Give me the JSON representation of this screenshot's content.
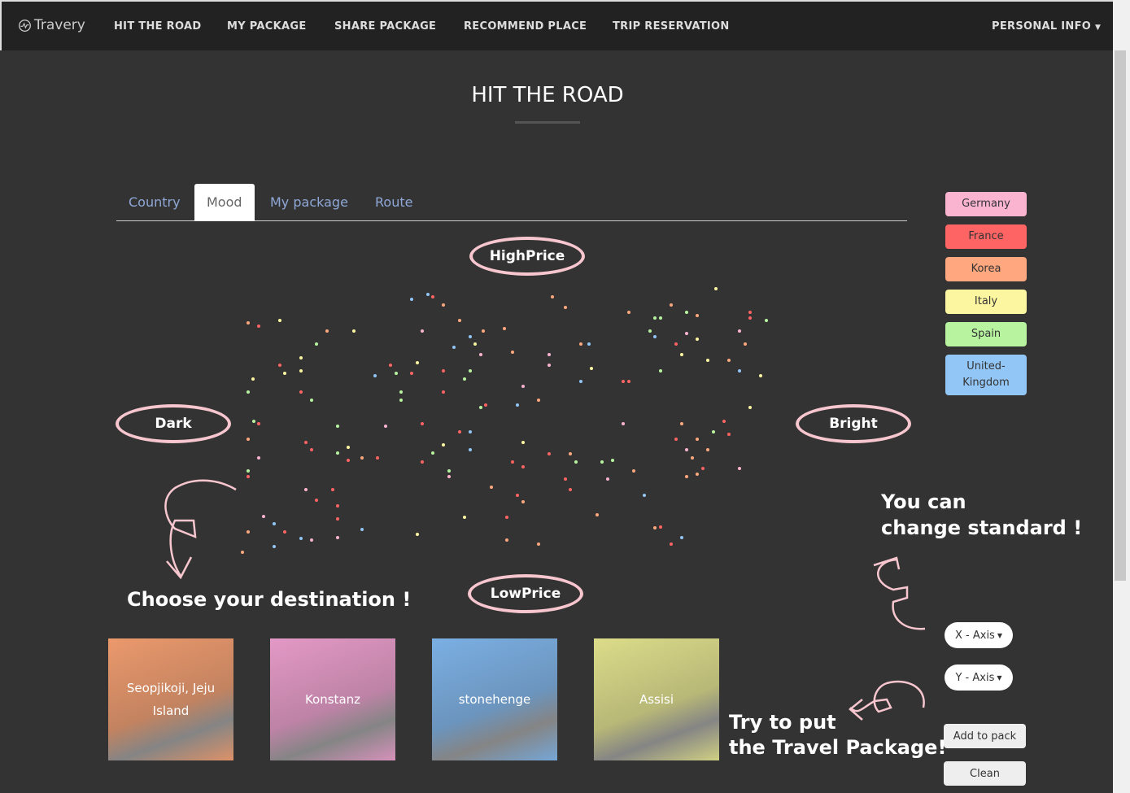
{
  "nav": {
    "brand": "Travery",
    "links": [
      "HIT THE ROAD",
      "MY PACKAGE",
      "SHARE PACKAGE",
      "RECOMMEND PLACE",
      "TRIP RESERVATION"
    ],
    "personal": "PERSONAL INFO"
  },
  "page_title": "HIT THE ROAD",
  "tabs": [
    "Country",
    "Mood",
    "My package",
    "Route"
  ],
  "active_tab": "Mood",
  "axes": {
    "top": "HighPrice",
    "bottom": "LowPrice",
    "left": "Dark",
    "right": "Bright"
  },
  "legend": [
    {
      "label": "Germany",
      "color": "#fbb4d0"
    },
    {
      "label": "France",
      "color": "#ff6464"
    },
    {
      "label": "Korea",
      "color": "#ffa77e"
    },
    {
      "label": "Italy",
      "color": "#fdf6a0"
    },
    {
      "label": "Spain",
      "color": "#b8f4a0"
    },
    {
      "label": "United-Kingdom",
      "color": "#92c6f7"
    }
  ],
  "annotations": {
    "choose": "Choose your destination !",
    "change1": "You can",
    "change2": "change standard !",
    "try1": "Try to put",
    "try2": "the Travel Package!"
  },
  "cards": [
    {
      "label": "Seopjikoji, Jeju Island",
      "tint": "#f8a070"
    },
    {
      "label": "Konstanz",
      "tint": "#f0a0d0"
    },
    {
      "label": "stonehenge",
      "tint": "#80b8f0"
    },
    {
      "label": "Assisi",
      "tint": "#e8e890"
    }
  ],
  "controls": {
    "x_axis": "X - Axis",
    "y_axis": "Y - Axis",
    "add": "Add to pack",
    "clean": "Clean"
  },
  "chart_data": {
    "type": "scatter",
    "xlabel": "Dark → Bright",
    "ylabel": "LowPrice → HighPrice",
    "xlim": [
      0,
      100
    ],
    "ylim": [
      0,
      100
    ],
    "series_key": {
      "G": "Germany",
      "F": "France",
      "K": "Korea",
      "I": "Italy",
      "S": "Spain",
      "U": "United-Kingdom"
    },
    "points": [
      [
        1.5,
        87,
        "K"
      ],
      [
        3.5,
        86,
        "F"
      ],
      [
        7.5,
        88,
        "I"
      ],
      [
        16.5,
        84,
        "K"
      ],
      [
        21.5,
        84,
        "I"
      ],
      [
        14.5,
        79,
        "S"
      ],
      [
        11.5,
        74,
        "I"
      ],
      [
        7.5,
        71,
        "F"
      ],
      [
        8.5,
        68,
        "I"
      ],
      [
        11.5,
        69,
        "I"
      ],
      [
        2.5,
        66,
        "I"
      ],
      [
        1.5,
        61,
        "S"
      ],
      [
        11.5,
        61,
        "F"
      ],
      [
        13.5,
        58,
        "S"
      ],
      [
        2.6,
        50,
        "S"
      ],
      [
        3.5,
        49,
        "F"
      ],
      [
        1.5,
        43,
        "K"
      ],
      [
        12.5,
        42,
        "F"
      ],
      [
        13.5,
        39,
        "F"
      ],
      [
        18.5,
        48,
        "S"
      ],
      [
        18.5,
        38,
        "S"
      ],
      [
        20.5,
        40,
        "I"
      ],
      [
        20.5,
        35,
        "F"
      ],
      [
        3.5,
        36,
        "G"
      ],
      [
        1.5,
        31,
        "S"
      ],
      [
        1.5,
        29,
        "F"
      ],
      [
        12.5,
        24,
        "G"
      ],
      [
        17.5,
        24,
        "F"
      ],
      [
        14.5,
        20,
        "F"
      ],
      [
        18.5,
        18,
        "F"
      ],
      [
        18.5,
        13,
        "F"
      ],
      [
        4.5,
        14,
        "G"
      ],
      [
        6.5,
        11,
        "U"
      ],
      [
        8.5,
        8,
        "F"
      ],
      [
        11.5,
        5.5,
        "U"
      ],
      [
        13.5,
        5,
        "G"
      ],
      [
        18.5,
        6,
        "G"
      ],
      [
        1.5,
        8,
        "K"
      ],
      [
        0.5,
        0.3,
        "K"
      ],
      [
        6.5,
        2.5,
        "U"
      ],
      [
        23,
        9,
        "U"
      ],
      [
        33.5,
        7,
        "I"
      ],
      [
        32.5,
        96,
        "U"
      ],
      [
        35.5,
        98,
        "U"
      ],
      [
        36.5,
        97,
        "F"
      ],
      [
        38.5,
        94,
        "K"
      ],
      [
        34.5,
        84,
        "G"
      ],
      [
        41.5,
        88,
        "K"
      ],
      [
        43.5,
        82,
        "U"
      ],
      [
        44.5,
        79,
        "I"
      ],
      [
        45.5,
        75,
        "G"
      ],
      [
        46,
        84,
        "K"
      ],
      [
        40.5,
        78,
        "U"
      ],
      [
        50,
        85,
        "K"
      ],
      [
        59,
        97,
        "K"
      ],
      [
        61.5,
        93,
        "K"
      ],
      [
        33.5,
        72,
        "I"
      ],
      [
        28.5,
        71,
        "F"
      ],
      [
        29.5,
        68,
        "S"
      ],
      [
        25.5,
        67,
        "U"
      ],
      [
        32.5,
        68,
        "F"
      ],
      [
        38.5,
        69,
        "F"
      ],
      [
        43.5,
        69,
        "S"
      ],
      [
        42.5,
        66,
        "S"
      ],
      [
        38.5,
        61,
        "F"
      ],
      [
        30.5,
        61,
        "S"
      ],
      [
        30.5,
        58,
        "S"
      ],
      [
        51.5,
        76,
        "K"
      ],
      [
        58.5,
        75,
        "G"
      ],
      [
        58.5,
        71,
        "G"
      ],
      [
        53.5,
        63,
        "G"
      ],
      [
        56.5,
        58,
        "K"
      ],
      [
        52.5,
        56,
        "U"
      ],
      [
        46.5,
        56,
        "F"
      ],
      [
        45.5,
        55,
        "S"
      ],
      [
        34.5,
        49,
        "F"
      ],
      [
        27.5,
        48,
        "G"
      ],
      [
        41.5,
        46,
        "F"
      ],
      [
        43.5,
        46,
        "U"
      ],
      [
        36.5,
        38,
        "S"
      ],
      [
        38.5,
        41,
        "I"
      ],
      [
        43.5,
        39,
        "U"
      ],
      [
        23,
        36,
        "K"
      ],
      [
        26,
        36,
        "F"
      ],
      [
        34.5,
        34.5,
        "F"
      ],
      [
        39.5,
        31,
        "S"
      ],
      [
        39.5,
        29,
        "G"
      ],
      [
        47.5,
        25,
        "K"
      ],
      [
        53.5,
        42,
        "I"
      ],
      [
        51.5,
        34.5,
        "F"
      ],
      [
        53.5,
        32.5,
        "F"
      ],
      [
        58.5,
        37.5,
        "F"
      ],
      [
        62.5,
        37.5,
        "K"
      ],
      [
        61.5,
        28,
        "F"
      ],
      [
        62.5,
        24,
        "F"
      ],
      [
        52.5,
        22,
        "F"
      ],
      [
        53.5,
        19.5,
        "K"
      ],
      [
        50.5,
        13.5,
        "F"
      ],
      [
        42.5,
        13.5,
        "I"
      ],
      [
        50.5,
        5,
        "K"
      ],
      [
        56.5,
        3.5,
        "K"
      ],
      [
        64.5,
        79,
        "K"
      ],
      [
        66,
        79,
        "U"
      ],
      [
        66.5,
        70,
        "I"
      ],
      [
        64.5,
        65,
        "U"
      ],
      [
        73.5,
        91,
        "K"
      ],
      [
        78.5,
        89,
        "S"
      ],
      [
        79.5,
        89,
        "S"
      ],
      [
        81.5,
        94,
        "K"
      ],
      [
        84.5,
        91,
        "S"
      ],
      [
        86.5,
        90,
        "K"
      ],
      [
        90,
        100,
        "I"
      ],
      [
        96.5,
        91,
        "F"
      ],
      [
        96.5,
        89,
        "F"
      ],
      [
        99.5,
        88,
        "S"
      ],
      [
        77.5,
        84,
        "S"
      ],
      [
        78.5,
        82,
        "U"
      ],
      [
        84.5,
        83,
        "G"
      ],
      [
        86.5,
        81,
        "I"
      ],
      [
        94.5,
        84,
        "G"
      ],
      [
        95.5,
        79,
        "K"
      ],
      [
        82.5,
        79,
        "F"
      ],
      [
        83.5,
        75,
        "I"
      ],
      [
        88.5,
        73,
        "I"
      ],
      [
        92.5,
        73,
        "K"
      ],
      [
        94.5,
        69,
        "U"
      ],
      [
        98.5,
        67,
        "I"
      ],
      [
        79.5,
        69,
        "S"
      ],
      [
        72.5,
        65,
        "F"
      ],
      [
        73.5,
        65,
        "F"
      ],
      [
        96.5,
        55,
        "I"
      ],
      [
        72.5,
        49,
        "G"
      ],
      [
        83.5,
        49,
        "K"
      ],
      [
        89.5,
        46,
        "S"
      ],
      [
        91.5,
        50,
        "F"
      ],
      [
        82.5,
        43,
        "F"
      ],
      [
        86.5,
        43,
        "K"
      ],
      [
        92.5,
        45,
        "F"
      ],
      [
        84.5,
        39,
        "G"
      ],
      [
        88.5,
        39,
        "K"
      ],
      [
        85.5,
        36,
        "K"
      ],
      [
        68.5,
        34.5,
        "S"
      ],
      [
        70.5,
        35,
        "S"
      ],
      [
        69.5,
        28,
        "G"
      ],
      [
        74.5,
        31,
        "K"
      ],
      [
        87.5,
        32,
        "F"
      ],
      [
        86.5,
        30,
        "K"
      ],
      [
        94.5,
        32,
        "G"
      ],
      [
        84.5,
        29,
        "K"
      ],
      [
        76.5,
        22,
        "U"
      ],
      [
        67.5,
        14.5,
        "K"
      ],
      [
        78.5,
        9.5,
        "K"
      ],
      [
        79.5,
        10,
        "F"
      ],
      [
        83.5,
        6,
        "U"
      ],
      [
        81.5,
        3.5,
        "F"
      ],
      [
        63.5,
        34.5,
        "S"
      ]
    ]
  }
}
